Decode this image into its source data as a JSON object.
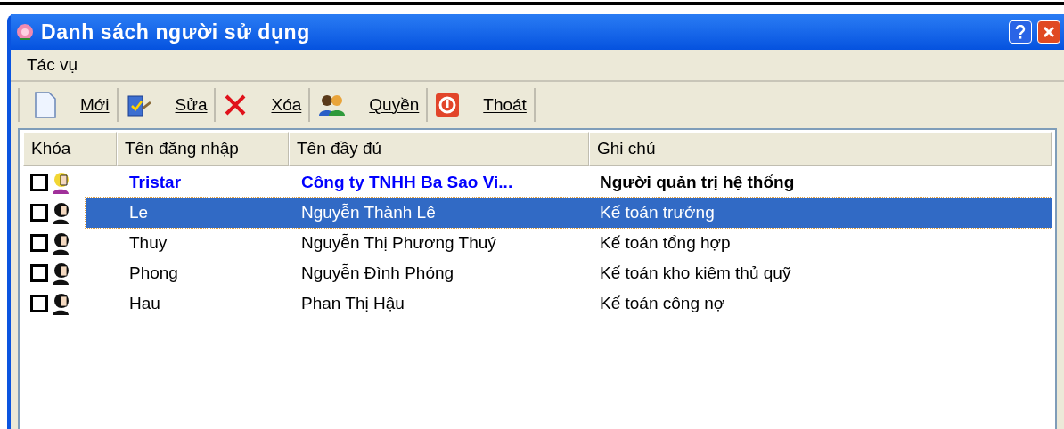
{
  "window": {
    "title": "Danh sách người sử dụng"
  },
  "menu": [
    "Tác vụ"
  ],
  "toolbar": [
    {
      "kind": "new",
      "label": "Mới"
    },
    {
      "kind": "edit",
      "label": "Sửa"
    },
    {
      "kind": "delete",
      "label": "Xóa"
    },
    {
      "kind": "rights",
      "label": "Quyền"
    },
    {
      "kind": "exit",
      "label": "Thoát"
    }
  ],
  "table": {
    "columns": [
      "Khóa",
      "Tên đăng nhập",
      "Tên đầy đủ",
      "Ghi chú"
    ],
    "rows": [
      {
        "kind": "admin",
        "checked": false,
        "selected": false,
        "username": "Tristar",
        "full_name": "Công ty TNHH Ba Sao Vi...",
        "note": "Người quản trị hệ thống"
      },
      {
        "kind": "user",
        "checked": false,
        "selected": true,
        "username": "Le",
        "full_name": "Nguyễn Thành Lê",
        "note": "Kế toán trưởng"
      },
      {
        "kind": "user",
        "checked": false,
        "selected": false,
        "username": "Thuy",
        "full_name": "Nguyễn Thị Phương Thuý",
        "note": "Kế toán tổng hợp"
      },
      {
        "kind": "user",
        "checked": false,
        "selected": false,
        "username": "Phong",
        "full_name": "Nguyễn Đình Phóng",
        "note": "Kế toán kho kiêm thủ quỹ"
      },
      {
        "kind": "user",
        "checked": false,
        "selected": false,
        "username": "Hau",
        "full_name": "Phan Thị Hậu",
        "note": "Kế toán công nợ"
      }
    ]
  }
}
